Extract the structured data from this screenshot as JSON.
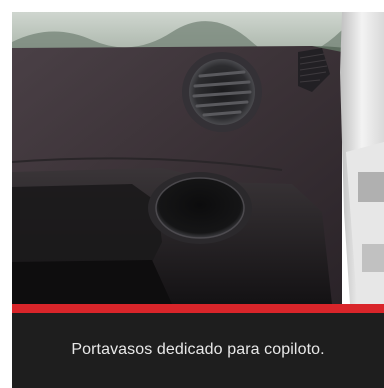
{
  "caption": {
    "text": "Portavasos dedicado para copiloto."
  },
  "colors": {
    "accent_bar": "#d9252a",
    "caption_background": "#1e1e1e",
    "caption_text": "#e8e8e8"
  }
}
